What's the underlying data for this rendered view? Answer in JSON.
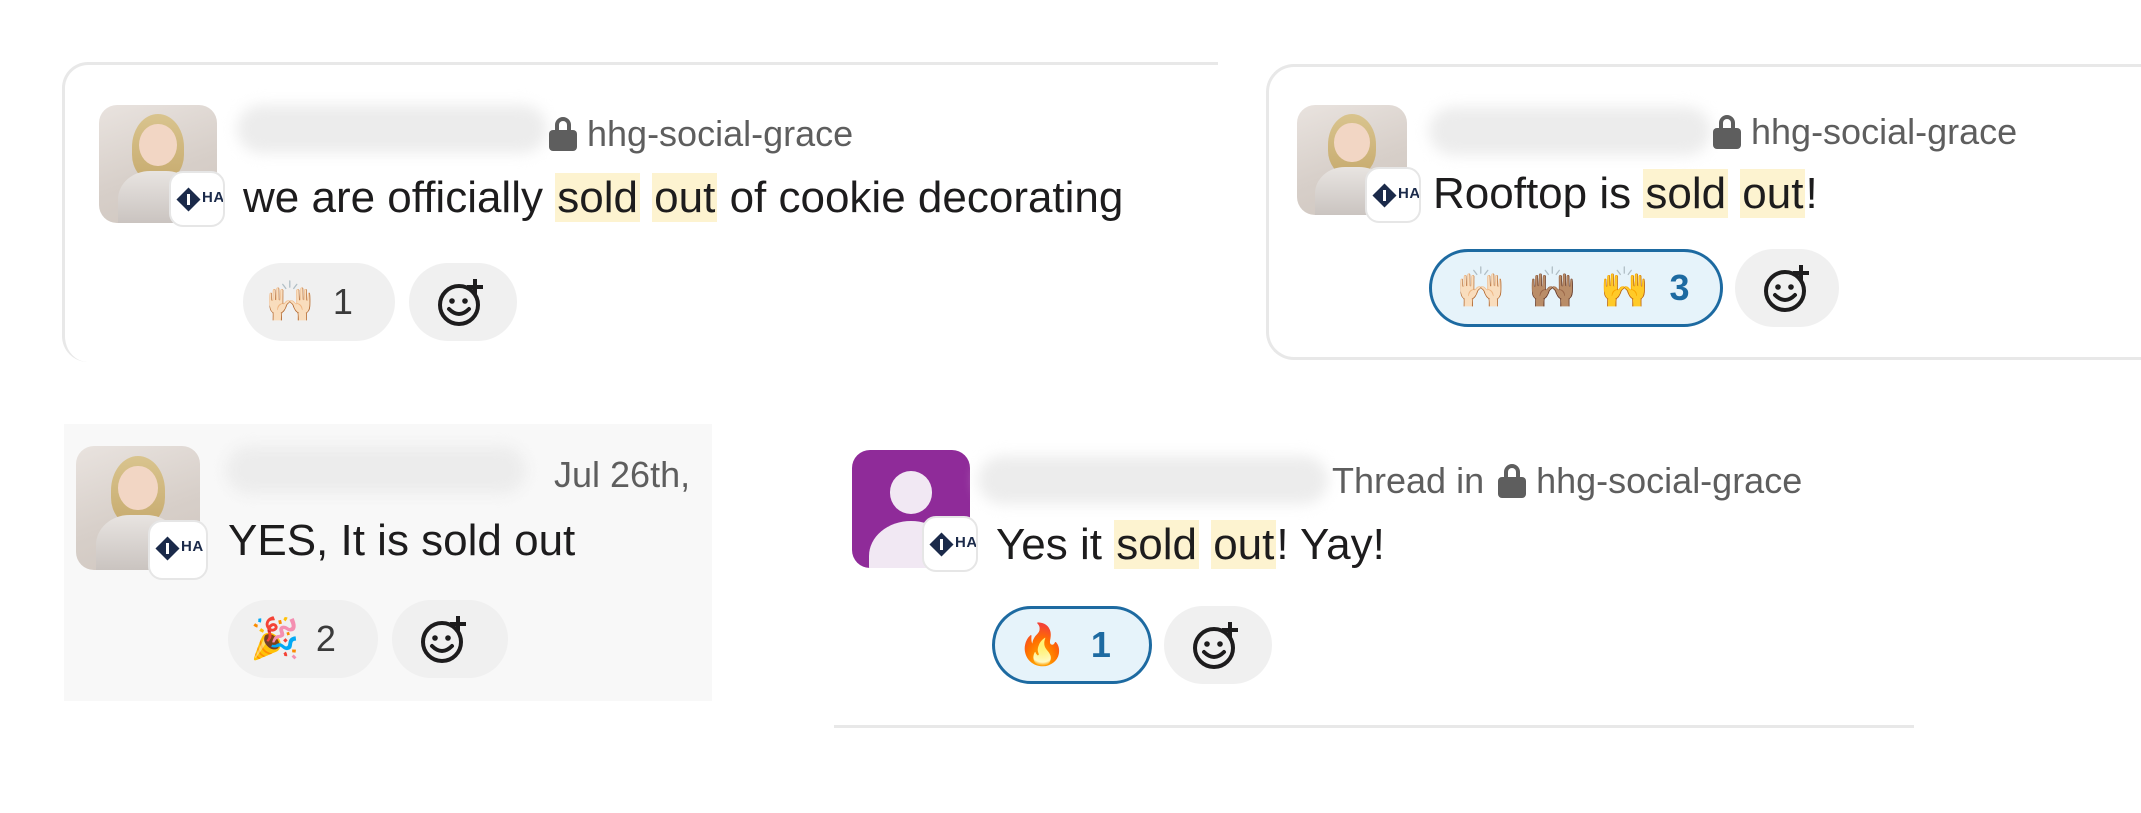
{
  "colors": {
    "highlight": "#fdf3d0",
    "active_reaction_border": "#1d6aa1",
    "active_reaction_bg": "#e6f3fa",
    "generic_avatar": "#8f2b99"
  },
  "messages": [
    {
      "channel": "hhg-social-grace",
      "text_before": "we are officially ",
      "hl1": "sold",
      "mid": " ",
      "hl2": "out",
      "text_after": " of cookie decorating",
      "reactions": [
        {
          "emoji_icons": [
            "raising-hands-light-icon"
          ],
          "count": "1",
          "active": false
        }
      ]
    },
    {
      "channel": "hhg-social-grace",
      "text_before": "Rooftop is ",
      "hl1": "sold",
      "mid": " ",
      "hl2": "out",
      "text_after": "!",
      "reactions": [
        {
          "emoji_icons": [
            "raising-hands-light-icon",
            "raising-hands-medium-icon",
            "raising-hands-yellow-icon"
          ],
          "count": "3",
          "active": true
        }
      ]
    },
    {
      "date": "Jul 26th,",
      "text": "YES, It is sold out",
      "reactions": [
        {
          "emoji_icons": [
            "party-popper-icon"
          ],
          "count": "2",
          "active": false
        }
      ]
    },
    {
      "thread_prefix": "Thread in",
      "channel": "hhg-social-grace",
      "text_before": "Yes it ",
      "hl1": "sold",
      "mid": " ",
      "hl2": "out",
      "text_after": "! Yay!",
      "reactions": [
        {
          "emoji_icons": [
            "fire-icon"
          ],
          "count": "1",
          "active": true
        }
      ]
    }
  ],
  "badge_letters": "HA"
}
